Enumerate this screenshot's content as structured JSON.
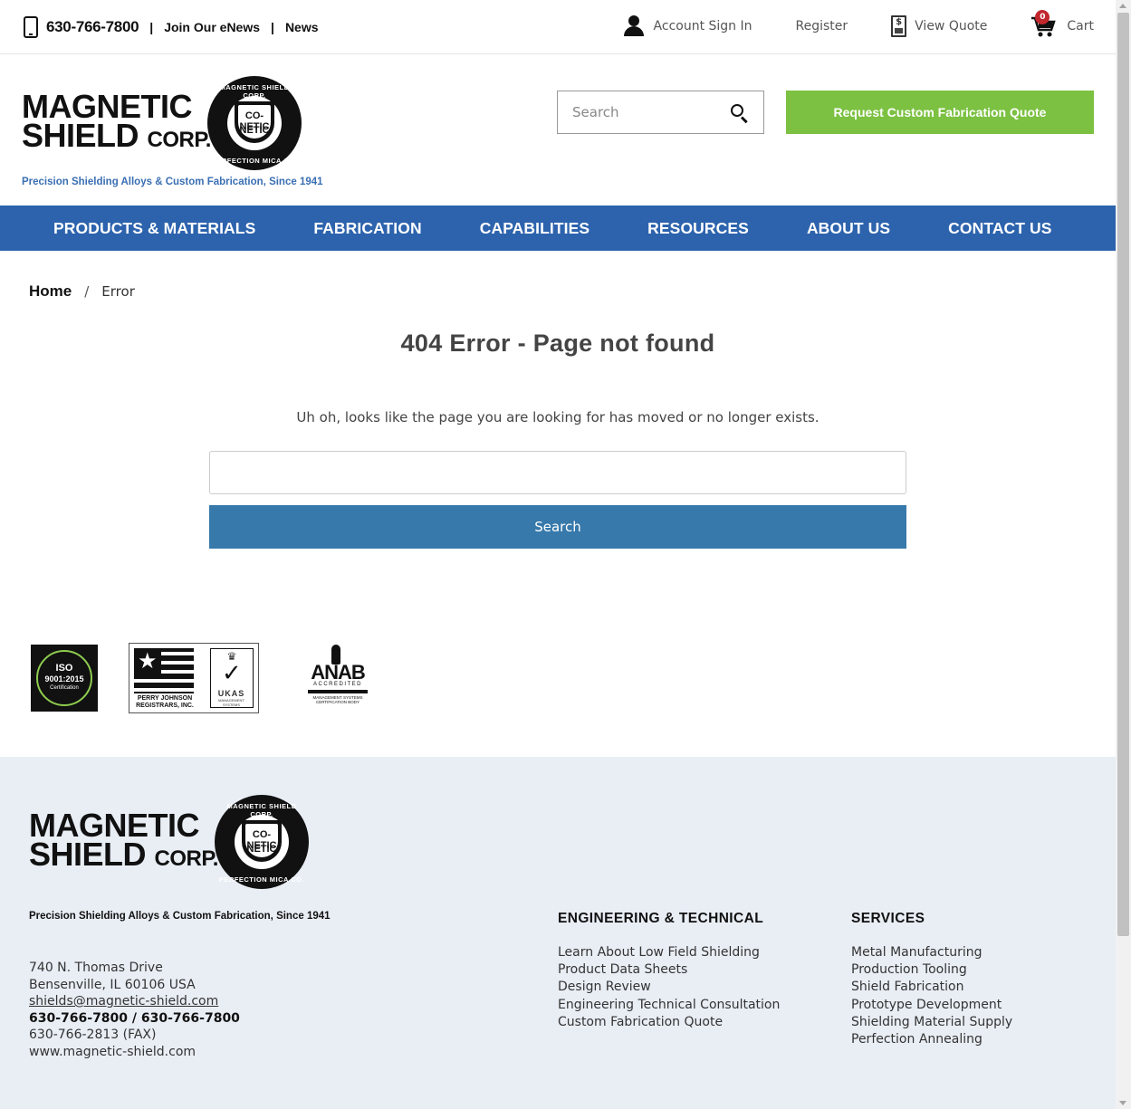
{
  "topbar": {
    "phone": "630-766-7800",
    "separator": "|",
    "links": [
      "Join Our eNews",
      "News"
    ],
    "account_sign_in": "Account Sign In",
    "register": "Register",
    "view_quote": "View Quote",
    "cart": "Cart",
    "cart_count": "0",
    "quote_icon_symbol": "$"
  },
  "header": {
    "logo_line1": "MAGNETIC",
    "logo_line2": "SHIELD",
    "logo_corp": "CORP.",
    "seal_top": "MAGNETIC SHIELD CORP.",
    "seal_bottom": "PERFECTION MICA CO.",
    "seal_center1": "CO-NETIC",
    "seal_center2": "NETIC",
    "tagline": "Precision Shielding Alloys & Custom Fabrication, Since 1941",
    "search_placeholder": "Search",
    "cta_label": "Request Custom Fabrication Quote"
  },
  "nav": {
    "items": [
      "PRODUCTS & MATERIALS",
      "FABRICATION",
      "CAPABILITIES",
      "RESOURCES",
      "ABOUT US",
      "CONTACT US"
    ]
  },
  "breadcrumb": {
    "home": "Home",
    "separator": "/",
    "current": "Error"
  },
  "main": {
    "title": "404 Error - Page not found",
    "message": "Uh oh, looks like the page you are looking for has moved or no longer exists.",
    "search_value": "",
    "search_button": "Search"
  },
  "certifications": {
    "iso_line1": "ISO",
    "iso_line2": "9001:2015",
    "iso_line3": "Certification",
    "pjr_text": "PERRY JOHNSON REGISTRARS, INC.",
    "ukas": "UKAS",
    "ukas_sub": "MANAGEMENT SYSTEMS",
    "anab": "ANAB",
    "anab_sub": "ACCREDITED",
    "anab_body": "MANAGEMENT SYSTEMS CERTIFICATION BODY"
  },
  "footer": {
    "tagline": "Precision Shielding Alloys & Custom Fabrication, Since 1941",
    "address_line1": "740 N. Thomas Drive",
    "address_line2": "Bensenville, IL 60106 USA",
    "email": "shields@magnetic-shield.com",
    "phones": "630-766-7800 / 630-766-7800",
    "fax": "630-766-2813 (FAX)",
    "website": "www.magnetic-shield.com",
    "engineering": {
      "heading": "ENGINEERING & TECHNICAL",
      "links": [
        "Learn About Low Field Shielding",
        "Product Data Sheets",
        "Design Review",
        "Engineering Technical Consultation",
        "Custom Fabrication Quote"
      ]
    },
    "services": {
      "heading": "SERVICES",
      "links": [
        "Metal Manufacturing",
        "Production Tooling",
        "Shield Fabrication",
        "Prototype Development",
        "Shielding Material Supply",
        "Perfection Annealing"
      ]
    }
  },
  "colors": {
    "nav_blue": "#2d63ad",
    "cta_green": "#7cc142",
    "search_button_blue": "#3779ab",
    "tagline_blue": "#3a6fb3",
    "footer_bg": "#e9eef5",
    "cart_badge": "#c1272d"
  }
}
